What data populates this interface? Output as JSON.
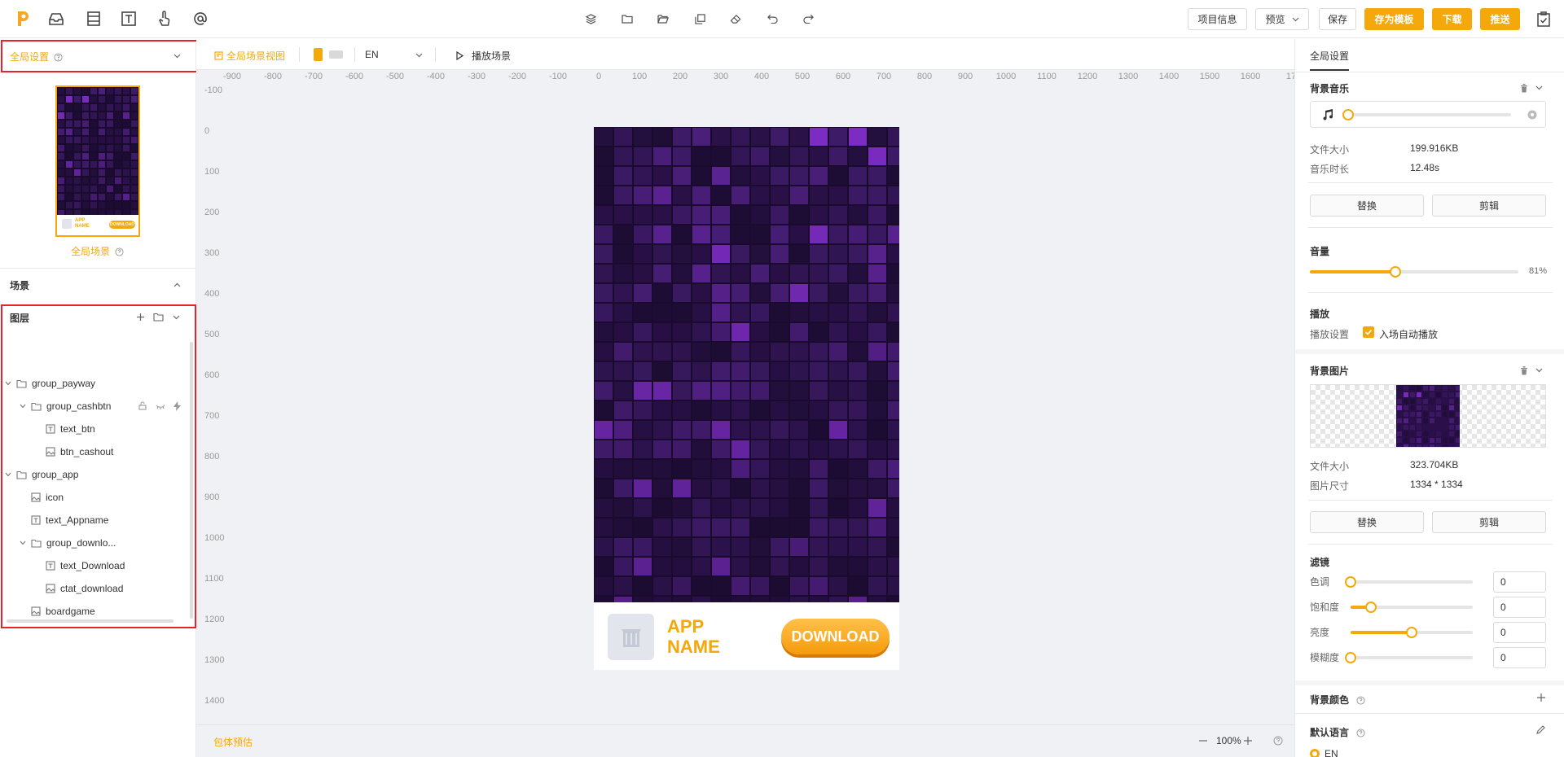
{
  "topbar": {
    "icons": [
      "inbox-icon",
      "layout-icon",
      "text-icon",
      "hand-icon",
      "at-icon"
    ],
    "center_icons": [
      "layers-icon",
      "folder-icon",
      "folder-open-icon",
      "copy-icon",
      "eraser-icon",
      "undo-icon",
      "redo-icon"
    ],
    "project_info": "项目信息",
    "preview": "预览",
    "save": "保存",
    "save_template": "存为模板",
    "download": "下载",
    "push": "推送"
  },
  "left": {
    "global_settings": "全局设置",
    "global_scene": "全局场景",
    "scene": "场景",
    "layers": "图层",
    "thumb_app": "APP",
    "thumb_name": "NAME",
    "thumb_download": "DOWNLOAD",
    "tree": [
      {
        "label": "group_payway",
        "type": "folder",
        "indent": 0,
        "expanded": true
      },
      {
        "label": "group_cashbtn",
        "type": "folder",
        "indent": 1,
        "expanded": true
      },
      {
        "label": "text_btn",
        "type": "text",
        "indent": 2
      },
      {
        "label": "btn_cashout",
        "type": "image",
        "indent": 2
      },
      {
        "label": "group_app",
        "type": "folder",
        "indent": 0,
        "expanded": true
      },
      {
        "label": "icon",
        "type": "image",
        "indent": 1
      },
      {
        "label": "text_Appname",
        "type": "text",
        "indent": 1
      },
      {
        "label": "group_downlo...",
        "type": "folder",
        "indent": 1,
        "expanded": true
      },
      {
        "label": "text_Download",
        "type": "text",
        "indent": 2
      },
      {
        "label": "ctat_download",
        "type": "image",
        "indent": 2
      },
      {
        "label": "boardgame",
        "type": "image",
        "indent": 1
      }
    ]
  },
  "canvas": {
    "scene_view": "全局场景视图",
    "language": "EN",
    "play_scene": "播放场景",
    "ruler_h": [
      "-900",
      "-800",
      "-700",
      "-600",
      "-500",
      "-400",
      "-300",
      "-200",
      "-100",
      "0",
      "100",
      "200",
      "300",
      "400",
      "500",
      "600",
      "700",
      "800",
      "900",
      "1000",
      "1100",
      "1200",
      "1300",
      "1400",
      "1500",
      "1600",
      "17"
    ],
    "ruler_v": [
      "-100",
      "0",
      "100",
      "200",
      "300",
      "400",
      "500",
      "600",
      "700",
      "800",
      "900",
      "1000",
      "1100",
      "1200",
      "1300",
      "1400"
    ],
    "app_line1": "APP",
    "app_line2": "NAME",
    "download_btn": "DOWNLOAD",
    "package_estimate": "包体预估",
    "zoom": "100%"
  },
  "right": {
    "tab": "全局设置",
    "bg_music": "背景音乐",
    "file_size_label": "文件大小",
    "music_size": "199.916KB",
    "music_duration_label": "音乐时长",
    "music_duration": "12.48s",
    "replace": "替换",
    "clip": "剪辑",
    "volume": "音量",
    "volume_value": "81%",
    "volume_fraction": 0.41,
    "playback": "播放",
    "play_settings": "播放设置",
    "autoplay": "入场自动播放",
    "bg_image": "背景图片",
    "image_size": "323.704KB",
    "image_dim_label": "图片尺寸",
    "image_dim": "1334 * 1334",
    "filter": "滤镜",
    "hue": "色调",
    "saturation": "饱和度",
    "brightness": "亮度",
    "blur": "模糊度",
    "hue_val": "0",
    "sat_val": "0",
    "bright_val": "0",
    "blur_val": "0",
    "bg_color": "背景颜色",
    "default_lang": "默认语言",
    "lang_en": "EN"
  },
  "colors": {
    "accent": "#f5a80a",
    "highlight": "#e8222a"
  }
}
